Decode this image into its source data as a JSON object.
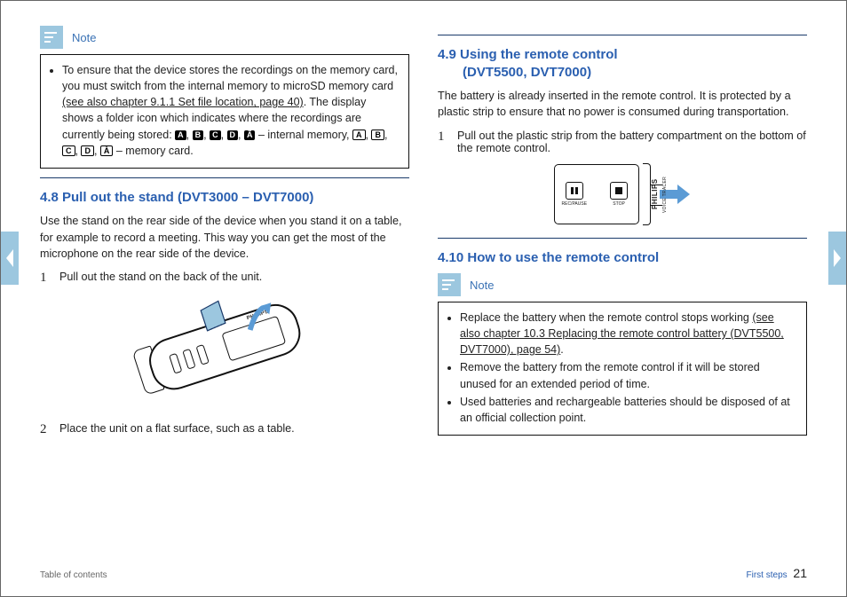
{
  "notes_label": "Note",
  "left": {
    "note1": {
      "text_a": "To ensure that the device stores the recordings on the memory card, you must switch from the internal memory to microSD memory card ",
      "link": "(see also chapter 9.1.1 Set file location, page 40)",
      "text_b": ". The display shows a folder icon which indicates where the recordings are currently being stored: ",
      "internal_badges": [
        "A",
        "B",
        "C",
        "D",
        "Ã"
      ],
      "internal_suffix": " – internal memory, ",
      "card_badges": [
        "A",
        "B",
        "C",
        "D",
        "À"
      ],
      "card_suffix": " – memory card."
    },
    "sec48_title": "4.8  Pull out the stand (DVT3000 – DVT7000)",
    "sec48_body": "Use the stand on the rear side of the device when you stand it on a table, for example to record a meeting. This way you can get the most of the microphone on the rear side of the device.",
    "sec48_step1": "Pull out the stand on the back of the unit.",
    "sec48_step2": "Place the unit on a flat surface, such as a table.",
    "device_brand": "PHILIPS"
  },
  "right": {
    "sec49_title_a": "4.9  Using the remote control",
    "sec49_title_b": "(DVT5500, DVT7000)",
    "sec49_body": "The battery is already inserted in the remote control. It is protected by a plastic strip to ensure that no power is consumed during transportation.",
    "sec49_step1": "Pull out the plastic strip from the battery compartment on the bottom of the remote control.",
    "remote": {
      "btn1_label": "REC/PAUSE",
      "btn2_label": "STOP",
      "brand": "PHILIPS",
      "sub": "VOICE TRACER"
    },
    "sec410_title": "4.10 How to use the remote control",
    "note2": {
      "li1_a": "Replace the battery when the remote control stops working ",
      "li1_link": "(see also chapter 10.3 Replacing the remote control battery (DVT5500, DVT7000), page 54)",
      "li1_b": ".",
      "li2": "Remove the battery from the remote control if it will be stored unused for an extended period of time.",
      "li3": "Used batteries and rechargeable batteries should be disposed of at an official collection point."
    }
  },
  "footer": {
    "toc": "Table of contents",
    "section": "First steps",
    "page": "21"
  }
}
